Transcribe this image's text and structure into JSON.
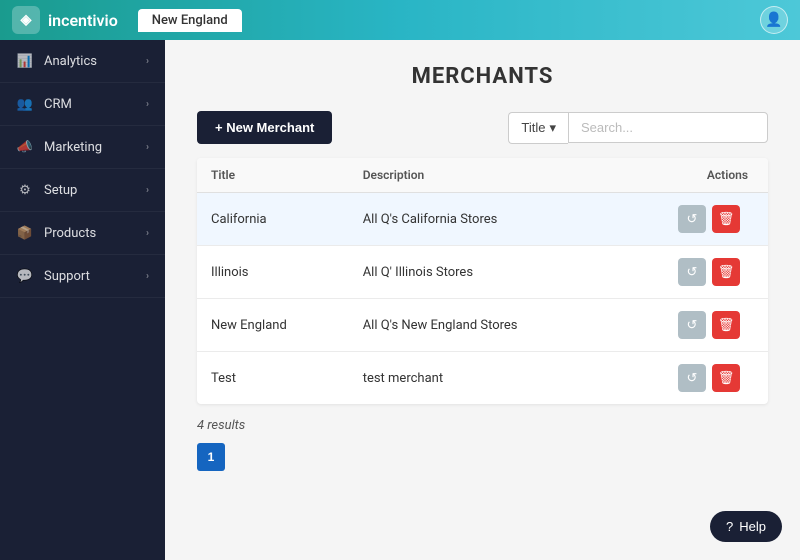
{
  "topbar": {
    "logo_text": "incentivio",
    "active_tab": "New England",
    "logo_icon": "◈"
  },
  "sidebar": {
    "items": [
      {
        "id": "analytics",
        "label": "Analytics",
        "icon": "📊"
      },
      {
        "id": "crm",
        "label": "CRM",
        "icon": "👥"
      },
      {
        "id": "marketing",
        "label": "Marketing",
        "icon": "📣"
      },
      {
        "id": "setup",
        "label": "Setup",
        "icon": "⚙"
      },
      {
        "id": "products",
        "label": "Products",
        "icon": "📦"
      },
      {
        "id": "support",
        "label": "Support",
        "icon": "💬"
      }
    ]
  },
  "page": {
    "title": "MERCHANTS",
    "new_merchant_label": "+ New Merchant",
    "search_filter_label": "Title",
    "search_placeholder": "Search...",
    "results_count": "4 results",
    "table": {
      "columns": [
        "Title",
        "Description",
        "Actions"
      ],
      "rows": [
        {
          "title": "California",
          "description": "All Q's California Stores",
          "highlighted": true
        },
        {
          "title": "Illinois",
          "description": "All Q' Illinois Stores",
          "highlighted": false
        },
        {
          "title": "New England",
          "description": "All Q's New England Stores",
          "highlighted": false
        },
        {
          "title": "Test",
          "description": "test merchant",
          "highlighted": false
        }
      ]
    },
    "pagination": [
      {
        "label": "1",
        "active": true
      }
    ]
  },
  "help_button": {
    "label": "Help",
    "icon": "?"
  }
}
